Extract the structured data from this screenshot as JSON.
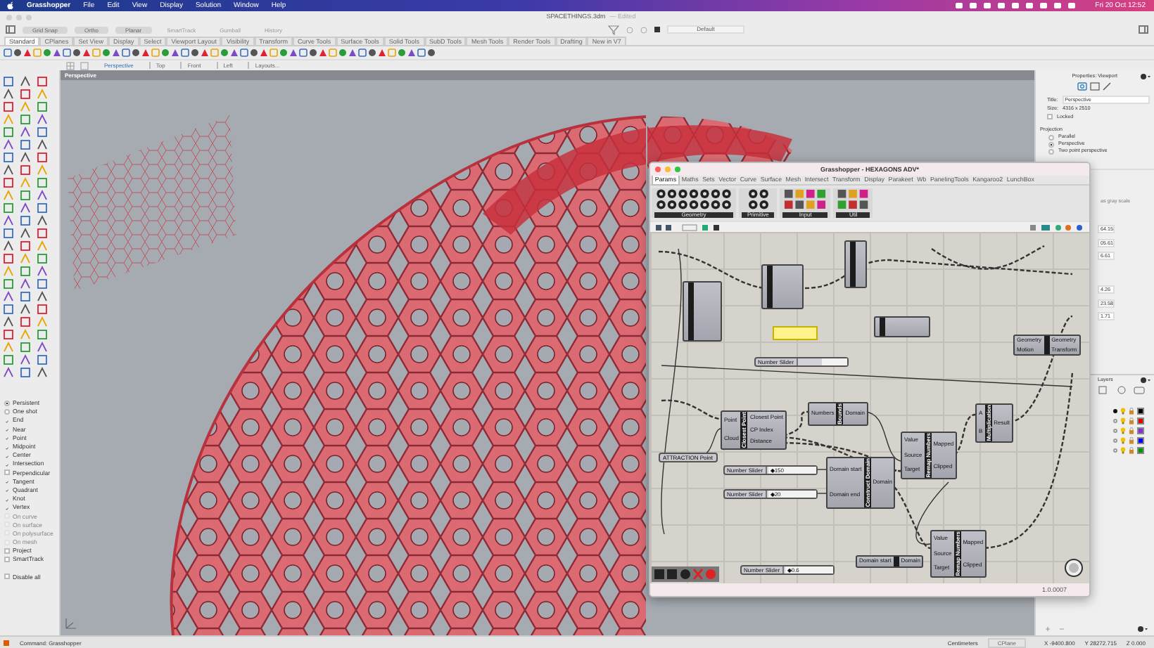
{
  "menu_bar": {
    "app": "Grasshopper",
    "items": [
      "File",
      "Edit",
      "View",
      "Display",
      "Solution",
      "Window",
      "Help"
    ],
    "clock": "Fri 20 Oct 12:52"
  },
  "window": {
    "title": "SPACETHINGS.3dm",
    "status": "— Edited"
  },
  "toggles": [
    {
      "label": "Grid Snap",
      "kind": "pill"
    },
    {
      "label": "Ortho",
      "kind": "pill"
    },
    {
      "label": "Planar",
      "kind": "pill"
    },
    {
      "label": "SmartTrack",
      "kind": "plain"
    },
    {
      "label": "Gumball",
      "kind": "plain"
    },
    {
      "label": "History",
      "kind": "plain"
    }
  ],
  "layer_field": {
    "value": "Default"
  },
  "toolbar_tabs": [
    {
      "label": "Standard",
      "selected": true
    },
    {
      "label": "CPlanes",
      "selected": false
    },
    {
      "label": "Set View",
      "selected": false
    },
    {
      "label": "Display",
      "selected": false
    },
    {
      "label": "Select",
      "selected": false
    },
    {
      "label": "Viewport Layout",
      "selected": false
    },
    {
      "label": "Visibility",
      "selected": false
    },
    {
      "label": "Transform",
      "selected": false
    },
    {
      "label": "Curve Tools",
      "selected": false
    },
    {
      "label": "Surface Tools",
      "selected": false
    },
    {
      "label": "Solid Tools",
      "selected": false
    },
    {
      "label": "SubD Tools",
      "selected": false
    },
    {
      "label": "Mesh Tools",
      "selected": false
    },
    {
      "label": "Render Tools",
      "selected": false
    },
    {
      "label": "Drafting",
      "selected": false
    },
    {
      "label": "New in V7",
      "selected": false
    }
  ],
  "viewport_tabs": [
    {
      "label": "Perspective",
      "selected": true
    },
    {
      "label": "Top",
      "selected": false
    },
    {
      "label": "Front",
      "selected": false
    },
    {
      "label": "Left",
      "selected": false
    },
    {
      "label": "Layouts...",
      "selected": false
    }
  ],
  "viewport": {
    "title": "Perspective"
  },
  "osnaps": {
    "modes": [
      {
        "label": "Persistent",
        "selected": true
      },
      {
        "label": "One shot",
        "selected": false
      }
    ],
    "items": [
      {
        "label": "End",
        "checked": true,
        "disabled": false
      },
      {
        "label": "Near",
        "checked": true,
        "disabled": false
      },
      {
        "label": "Point",
        "checked": true,
        "disabled": false
      },
      {
        "label": "Midpoint",
        "checked": true,
        "disabled": false
      },
      {
        "label": "Center",
        "checked": true,
        "disabled": false
      },
      {
        "label": "Intersection",
        "checked": true,
        "disabled": false
      },
      {
        "label": "Perpendicular",
        "checked": false,
        "disabled": false
      },
      {
        "label": "Tangent",
        "checked": true,
        "disabled": false
      },
      {
        "label": "Quadrant",
        "checked": true,
        "disabled": false
      },
      {
        "label": "Knot",
        "checked": true,
        "disabled": false
      },
      {
        "label": "Vertex",
        "checked": true,
        "disabled": false
      },
      {
        "label": "On curve",
        "checked": false,
        "disabled": true
      },
      {
        "label": "On surface",
        "checked": false,
        "disabled": true
      },
      {
        "label": "On polysurface",
        "checked": false,
        "disabled": true
      },
      {
        "label": "On mesh",
        "checked": false,
        "disabled": true
      },
      {
        "label": "Project",
        "checked": false,
        "disabled": false
      },
      {
        "label": "SmartTrack",
        "checked": false,
        "disabled": false
      }
    ],
    "disable_all": {
      "label": "Disable all",
      "checked": false
    }
  },
  "properties": {
    "title": "Properties: Viewport",
    "fields": [
      {
        "label": "Title:",
        "value": "Perspective"
      },
      {
        "label": "Size:",
        "value": "4316 x 2510"
      }
    ],
    "locked": {
      "label": "Locked",
      "checked": false
    },
    "projection": {
      "label": "Projection",
      "options": [
        {
          "label": "Parallel",
          "selected": false
        },
        {
          "label": "Perspective",
          "selected": true
        },
        {
          "label": "Two point perspective",
          "selected": false
        }
      ]
    },
    "note": "as gray scale",
    "values": [
      "64.15",
      "05.61",
      "6.61",
      "4.26",
      "23.58",
      "1.71"
    ]
  },
  "layers": {
    "title": "Layers",
    "rows": [
      {
        "current": true,
        "color": "#000000"
      },
      {
        "current": false,
        "color": "#e00000"
      },
      {
        "current": false,
        "color": "#8a2be2"
      },
      {
        "current": false,
        "color": "#0000ff"
      },
      {
        "current": false,
        "color": "#009a00"
      }
    ]
  },
  "grasshopper": {
    "title": "Grasshopper - HEXAGONS ADV*",
    "tabs": [
      {
        "label": "Params",
        "selected": true
      },
      {
        "label": "Maths",
        "selected": false
      },
      {
        "label": "Sets",
        "selected": false
      },
      {
        "label": "Vector",
        "selected": false
      },
      {
        "label": "Curve",
        "selected": false
      },
      {
        "label": "Surface",
        "selected": false
      },
      {
        "label": "Mesh",
        "selected": false
      },
      {
        "label": "Intersect",
        "selected": false
      },
      {
        "label": "Transform",
        "selected": false
      },
      {
        "label": "Display",
        "selected": false
      },
      {
        "label": "Parakeet",
        "selected": false
      },
      {
        "label": "Wb",
        "selected": false
      },
      {
        "label": "PanelingTools",
        "selected": false
      },
      {
        "label": "Kangaroo2",
        "selected": false
      },
      {
        "label": "LunchBox",
        "selected": false
      }
    ],
    "ribbon_groups": [
      "Geometry",
      "Primitive",
      "Input",
      "Util"
    ],
    "nodes": [
      {
        "kind": "component"
      },
      {
        "kind": "component"
      },
      {
        "kind": "component"
      },
      {
        "kind": "panel"
      },
      {
        "kind": "slider",
        "name": "Number Slider",
        "level": 0.5
      },
      {
        "kind": "component"
      },
      {
        "kind": "component",
        "inputs": [
          "Geometry",
          "Motion"
        ],
        "outputs": [
          "Geometry",
          "Transform"
        ]
      },
      {
        "kind": "param",
        "name": "ATTRACTION Point"
      },
      {
        "kind": "component",
        "name": "Closest Point",
        "inputs": [
          "Point",
          "Cloud"
        ],
        "outputs": [
          "Closest Point",
          "CP Index",
          "Distance"
        ]
      },
      {
        "kind": "component",
        "name": "Bounds",
        "inputs": [
          "Numbers"
        ],
        "outputs": [
          "Domain"
        ]
      },
      {
        "kind": "component",
        "name": "Multiplication",
        "inputs": [
          "A",
          "B"
        ],
        "outputs": [
          "Result"
        ]
      },
      {
        "kind": "component",
        "name": "Remap Numbers",
        "inputs": [
          "Value",
          "Source",
          "Target"
        ],
        "outputs": [
          "Mapped",
          "Clipped"
        ]
      },
      {
        "kind": "slider",
        "name": "Number Slider",
        "value": "◆150",
        "level": 0.05
      },
      {
        "kind": "slider",
        "name": "Number Slider",
        "value": "◆20",
        "level": 0.05
      },
      {
        "kind": "component",
        "name": "Construct Domain",
        "inputs": [
          "Domain start",
          "Domain end"
        ],
        "outputs": [
          "Domain"
        ]
      },
      {
        "kind": "component",
        "name": "Remap Numbers",
        "inputs": [
          "Value",
          "Source",
          "Target"
        ],
        "outputs": [
          "Mapped",
          "Clipped"
        ]
      },
      {
        "kind": "slider",
        "name": "Number Slider",
        "value": "◆0.6",
        "level": 0.05
      },
      {
        "kind": "component",
        "inputs": [
          "Domain start"
        ],
        "outputs": [
          "Domain"
        ]
      }
    ],
    "version": "1.0.0007"
  },
  "status_bar": {
    "command": "Command: Grasshopper",
    "units": "Centimeters",
    "cplane": "CPlane",
    "x": "X -9400.800",
    "y": "Y 28272.715",
    "z": "Z 0.000"
  }
}
